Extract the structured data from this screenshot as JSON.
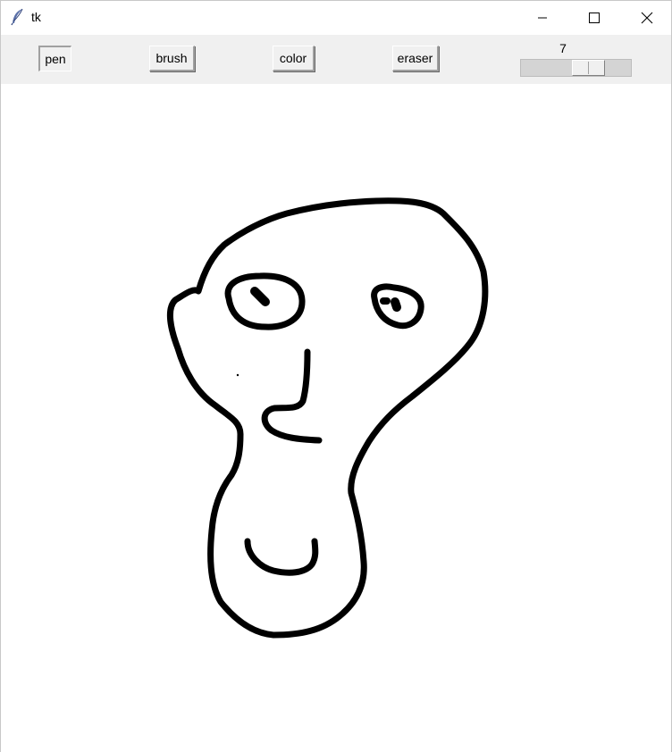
{
  "window": {
    "title": "tk",
    "icon": "feather-icon"
  },
  "title_bar_controls": {
    "minimize_icon": "minimize-icon",
    "maximize_icon": "maximize-icon",
    "close_icon": "close-icon"
  },
  "toolbar": {
    "pen_label": "pen",
    "brush_label": "brush",
    "color_label": "color",
    "eraser_label": "eraser",
    "active_tool": "pen",
    "size_scale": {
      "value": "7"
    }
  },
  "canvas": {
    "background": "#ffffff",
    "stroke_color": "#000000",
    "content": "hand-drawn-face-sketch"
  }
}
